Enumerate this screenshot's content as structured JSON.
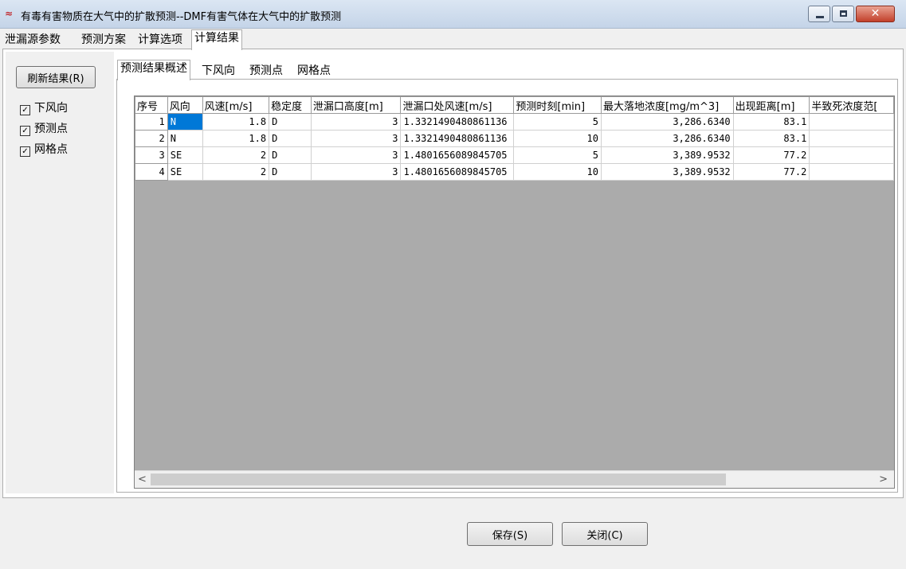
{
  "window": {
    "icon": "app-logo-icon",
    "title": "有毒有害物质在大气中的扩散预测--DMF有害气体在大气中的扩散预测"
  },
  "main_tabs": [
    "泄漏源参数",
    "预测方案",
    "计算选项",
    "计算结果"
  ],
  "active_main_tab": "计算结果",
  "left_panel": {
    "refresh_label": "刷新结果(R)",
    "checkboxes": [
      {
        "label": "下风向",
        "checked": true
      },
      {
        "label": "预测点",
        "checked": true
      },
      {
        "label": "网格点",
        "checked": true
      }
    ]
  },
  "sub_tabs": [
    "预测结果概述",
    "下风向",
    "预测点",
    "网格点"
  ],
  "active_sub_tab": "预测结果概述",
  "table": {
    "columns": [
      "序号",
      "风向",
      "风速[m/s]",
      "稳定度",
      "泄漏口高度[m]",
      "泄漏口处风速[m/s]",
      "预测时刻[min]",
      "最大落地浓度[mg/m^3]",
      "出现距离[m]",
      "半致死浓度范["
    ],
    "rows": [
      [
        "1",
        "N",
        "1.8",
        "D",
        "3",
        "1.3321490480861136",
        "5",
        "3,286.6340",
        "83.1",
        ""
      ],
      [
        "2",
        "N",
        "1.8",
        "D",
        "3",
        "1.3321490480861136",
        "10",
        "3,286.6340",
        "83.1",
        ""
      ],
      [
        "3",
        "SE",
        "2",
        "D",
        "3",
        "1.4801656089845705",
        "5",
        "3,389.9532",
        "77.2",
        ""
      ],
      [
        "4",
        "SE",
        "2",
        "D",
        "3",
        "1.4801656089845705",
        "10",
        "3,389.9532",
        "77.2",
        ""
      ]
    ]
  },
  "footer": {
    "save_label": "保存(S)",
    "close_label": "关闭(C)"
  }
}
